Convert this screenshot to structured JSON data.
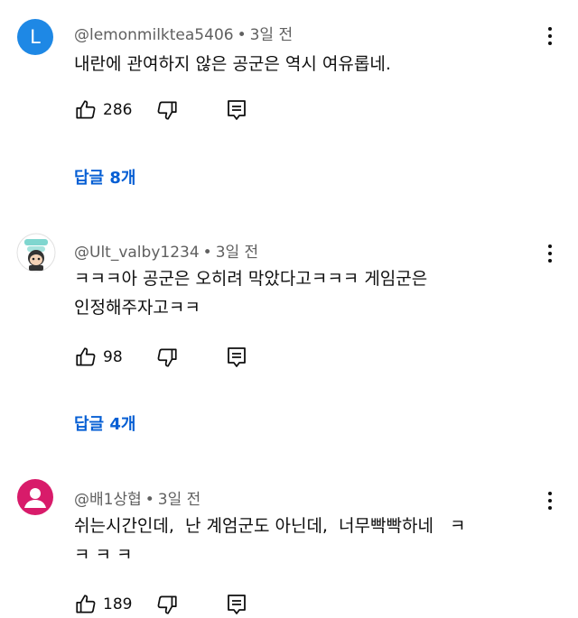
{
  "comments": [
    {
      "avatar_letter": "L",
      "username": "@lemonmilktea5406",
      "time": "3일 전",
      "text": "내란에 관여하지 않은 공군은 역시 여유롭네.",
      "likes": "286",
      "replies_label": "답글 8개"
    },
    {
      "username": "@Ult_valby1234",
      "time": "3일 전",
      "text_line1": "ㅋㅋㅋ아 공군은 오히려 막았다고ㅋㅋㅋ 게임군은",
      "text_line2": "인정해주자고ㅋㅋ",
      "likes": "98",
      "replies_label": "답글 4개"
    },
    {
      "username": "@배1상협",
      "time": "3일 전",
      "text_line1": "쉬는시간인데,  난 계엄군도 아닌데,  너무빡빡하네   ㅋ",
      "text_line2": "ㅋ ㅋ ㅋ",
      "likes": "189"
    }
  ],
  "separator": "•",
  "colors": {
    "link": "#065fd4",
    "meta": "#606060",
    "avatar1": "#1e88e5",
    "avatar3": "#d81b6a"
  }
}
